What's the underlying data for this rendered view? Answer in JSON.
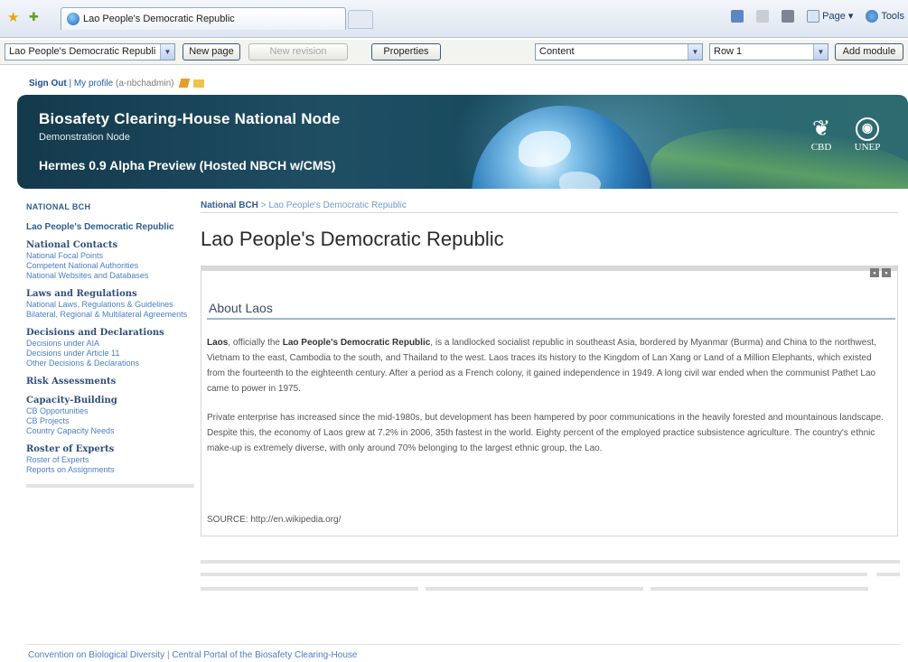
{
  "browser": {
    "tab_title": "Lao People's Democratic Republic",
    "commands": {
      "page": "Page",
      "tools": "Tools"
    }
  },
  "cms_toolbar": {
    "page_select": "Lao People's Democratic Republi",
    "new_page": "New page",
    "new_revision": "New revision",
    "properties": "Properties",
    "content_select": "Content",
    "row_select": "Row 1",
    "add_module": "Add module"
  },
  "user": {
    "sign_out": "Sign Out",
    "separator": "|",
    "my_profile": "My profile",
    "username": "(a-nbchadmin)"
  },
  "banner": {
    "title": "Biosafety Clearing-House National Node",
    "subtitle": "Demonstration Node",
    "edition": "Hermes 0.9 Alpha Preview (Hosted NBCH w/CMS)",
    "logo_cbd": "CBD",
    "logo_unep": "UNEP"
  },
  "nav": {
    "root": "NATIONAL BCH",
    "country": "Lao People's Democratic Republic",
    "sections": [
      {
        "title": "National Contacts",
        "links": [
          "National Focal Points",
          "Competent National Authorities",
          "National Websites and Databases"
        ]
      },
      {
        "title": "Laws and Regulations",
        "links": [
          "National Laws, Regulations & Guidelines",
          "Bilateral, Regional & Multilateral Agreements"
        ]
      },
      {
        "title": "Decisions and Declarations",
        "links": [
          "Decisions under AIA",
          "Decisions under Article 11",
          "Other Decisions & Declarations"
        ]
      },
      {
        "title": "Risk Assessments",
        "links": []
      },
      {
        "title": "Capacity-Building",
        "links": [
          "CB Opportunities",
          "CB Projects",
          "Country Capacity Needs"
        ]
      },
      {
        "title": "Roster of Experts",
        "links": [
          "Roster of Experts",
          "Reports on Assignments"
        ]
      }
    ]
  },
  "breadcrumb": {
    "root": "National BCH",
    "separator": ">",
    "current": "Lao People's Democratic Republic"
  },
  "page": {
    "title": "Lao People's Democratic Republic",
    "module": {
      "title": "About Laos",
      "p1": {
        "b1": "Laos",
        "t1": ", officially the ",
        "b2": "Lao People's Democratic Republic",
        "t2": ", is a landlocked socialist republic in southeast Asia, bordered by Myanmar (Burma) and China to the northwest, Vietnam to the east, Cambodia to the south, and Thailand to the west. Laos traces its history to the Kingdom of Lan Xang or Land of a Million Elephants, which existed from the fourteenth to the eighteenth century. After a period as a French colony, it gained independence in 1949. A long civil war ended when the communist Pathet Lao came to power in 1975."
      },
      "p2": "Private enterprise has increased since the mid-1980s, but development has been hampered by poor communications in the heavily forested and mountainous landscape. Despite this, the economy of Laos grew at 7.2% in 2006, 35th fastest in the world. Eighty percent of the employed practice subsistence agriculture. The country's ethnic make-up is extremely diverse, with only around 70% belonging to the largest ethnic group, the Lao.",
      "source": "SOURCE: http://en.wikipedia.org/"
    }
  },
  "footer": {
    "link1": "Convention on Biological Diversity",
    "separator": "|",
    "link2": "Central Portal of the Biosafety Clearing-House"
  }
}
